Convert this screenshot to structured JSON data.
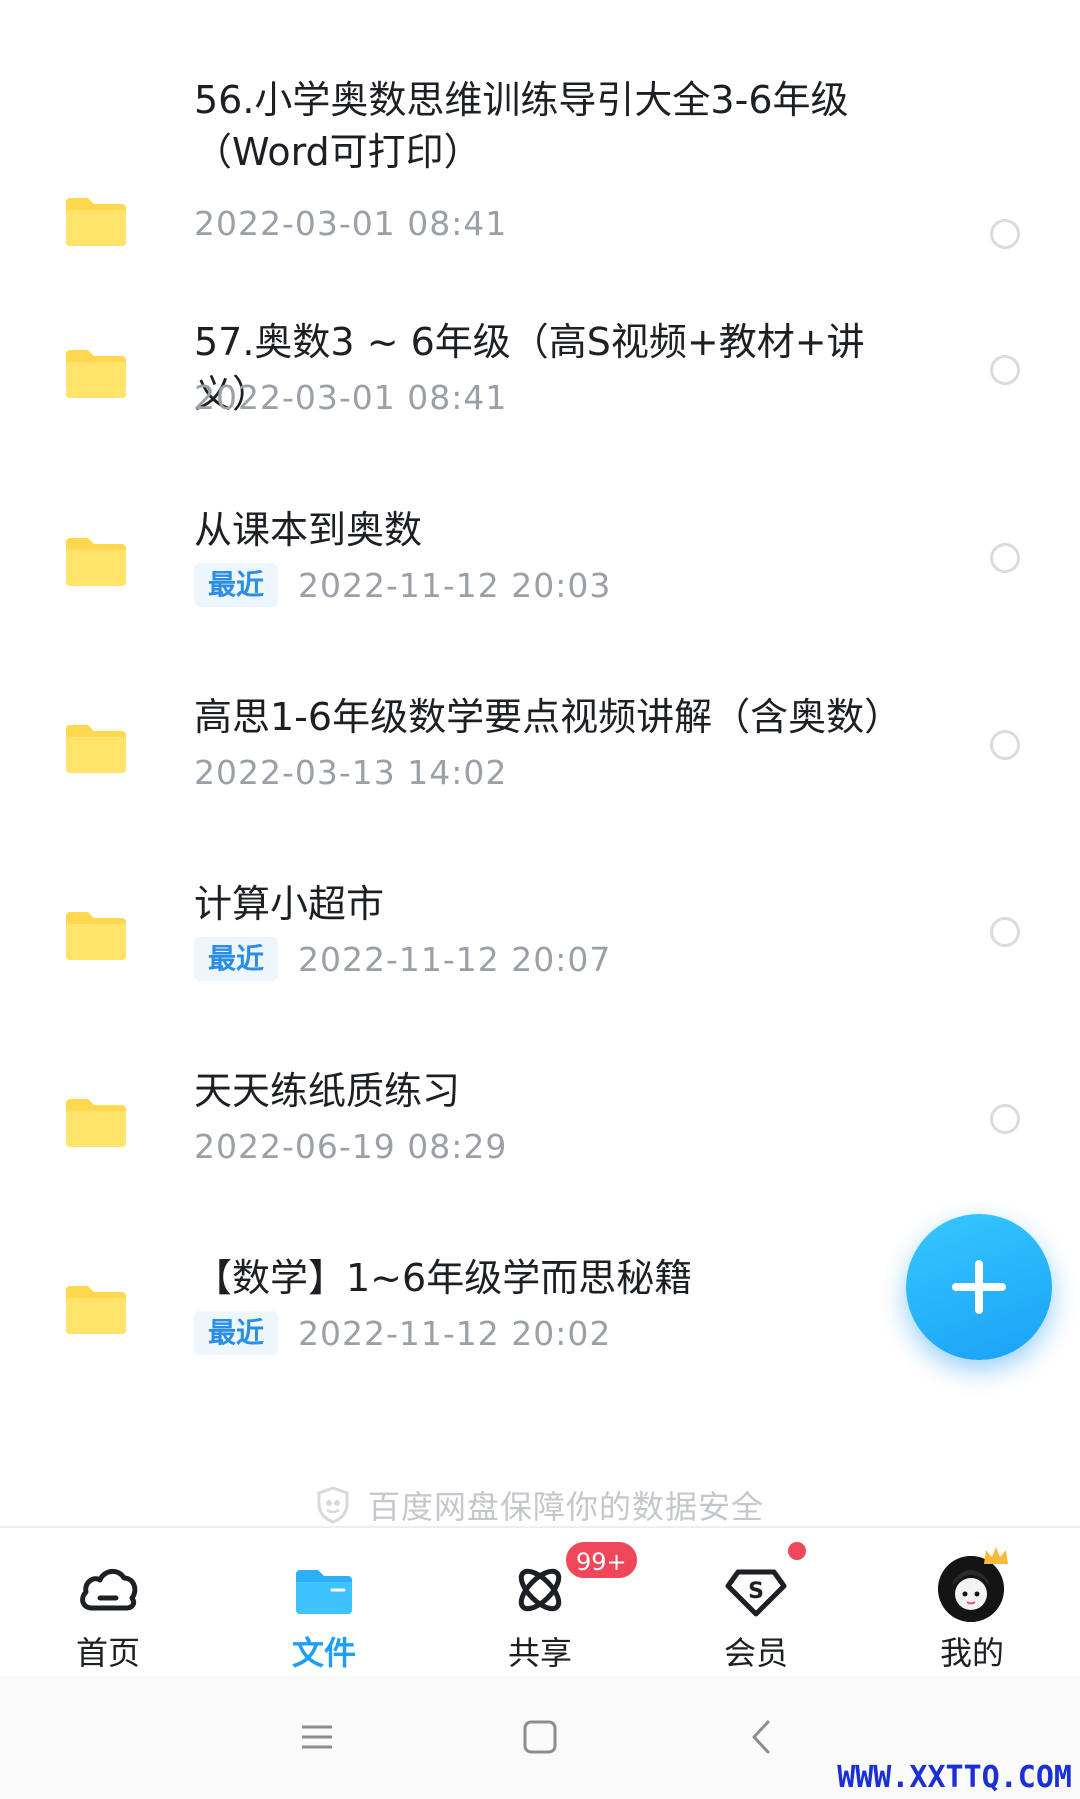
{
  "files": [
    {
      "name": "56.小学奥数思维训练导引大全3-6年级\n（Word可打印）",
      "tag": "",
      "date": "2022-03-01  08:41"
    },
    {
      "name": "57.奥数3 ~ 6年级（高S视频+教材+讲义）",
      "tag": "",
      "date": "2022-03-01  08:41"
    },
    {
      "name": "从课本到奥数",
      "tag": "最近",
      "date": "2022-11-12  20:03"
    },
    {
      "name": "高思1-6年级数学要点视频讲解（含奥数）",
      "tag": "",
      "date": "2022-03-13  14:02"
    },
    {
      "name": "计算小超市",
      "tag": "最近",
      "date": "2022-11-12  20:07"
    },
    {
      "name": "天天练纸质练习",
      "tag": "",
      "date": "2022-06-19  08:29"
    },
    {
      "name": "【数学】1~6年级学而思秘籍",
      "tag": "最近",
      "date": "2022-11-12  20:02"
    }
  ],
  "fab": {
    "icon": "plus-icon"
  },
  "safety_note": "百度网盘保障你的数据安全",
  "bottom_nav": {
    "items": [
      {
        "label": "首页",
        "icon": "cloud-home-icon",
        "active": false
      },
      {
        "label": "文件",
        "icon": "folder-icon",
        "active": true
      },
      {
        "label": "共享",
        "icon": "share-orbit-icon",
        "active": false,
        "badge": "99+"
      },
      {
        "label": "会员",
        "icon": "vip-diamond-icon",
        "active": false,
        "dot": true
      },
      {
        "label": "我的",
        "icon": "avatar",
        "active": false
      }
    ]
  },
  "system_nav": {
    "icons": [
      "menu-icon",
      "home-square-icon",
      "back-icon"
    ]
  },
  "watermark": "WWW.XXTTQ.COM",
  "colors": {
    "accent": "#1f9ef5",
    "folder": "#ffd84f",
    "badge": "#f0465a",
    "recent_tag": "#2a8de6"
  }
}
